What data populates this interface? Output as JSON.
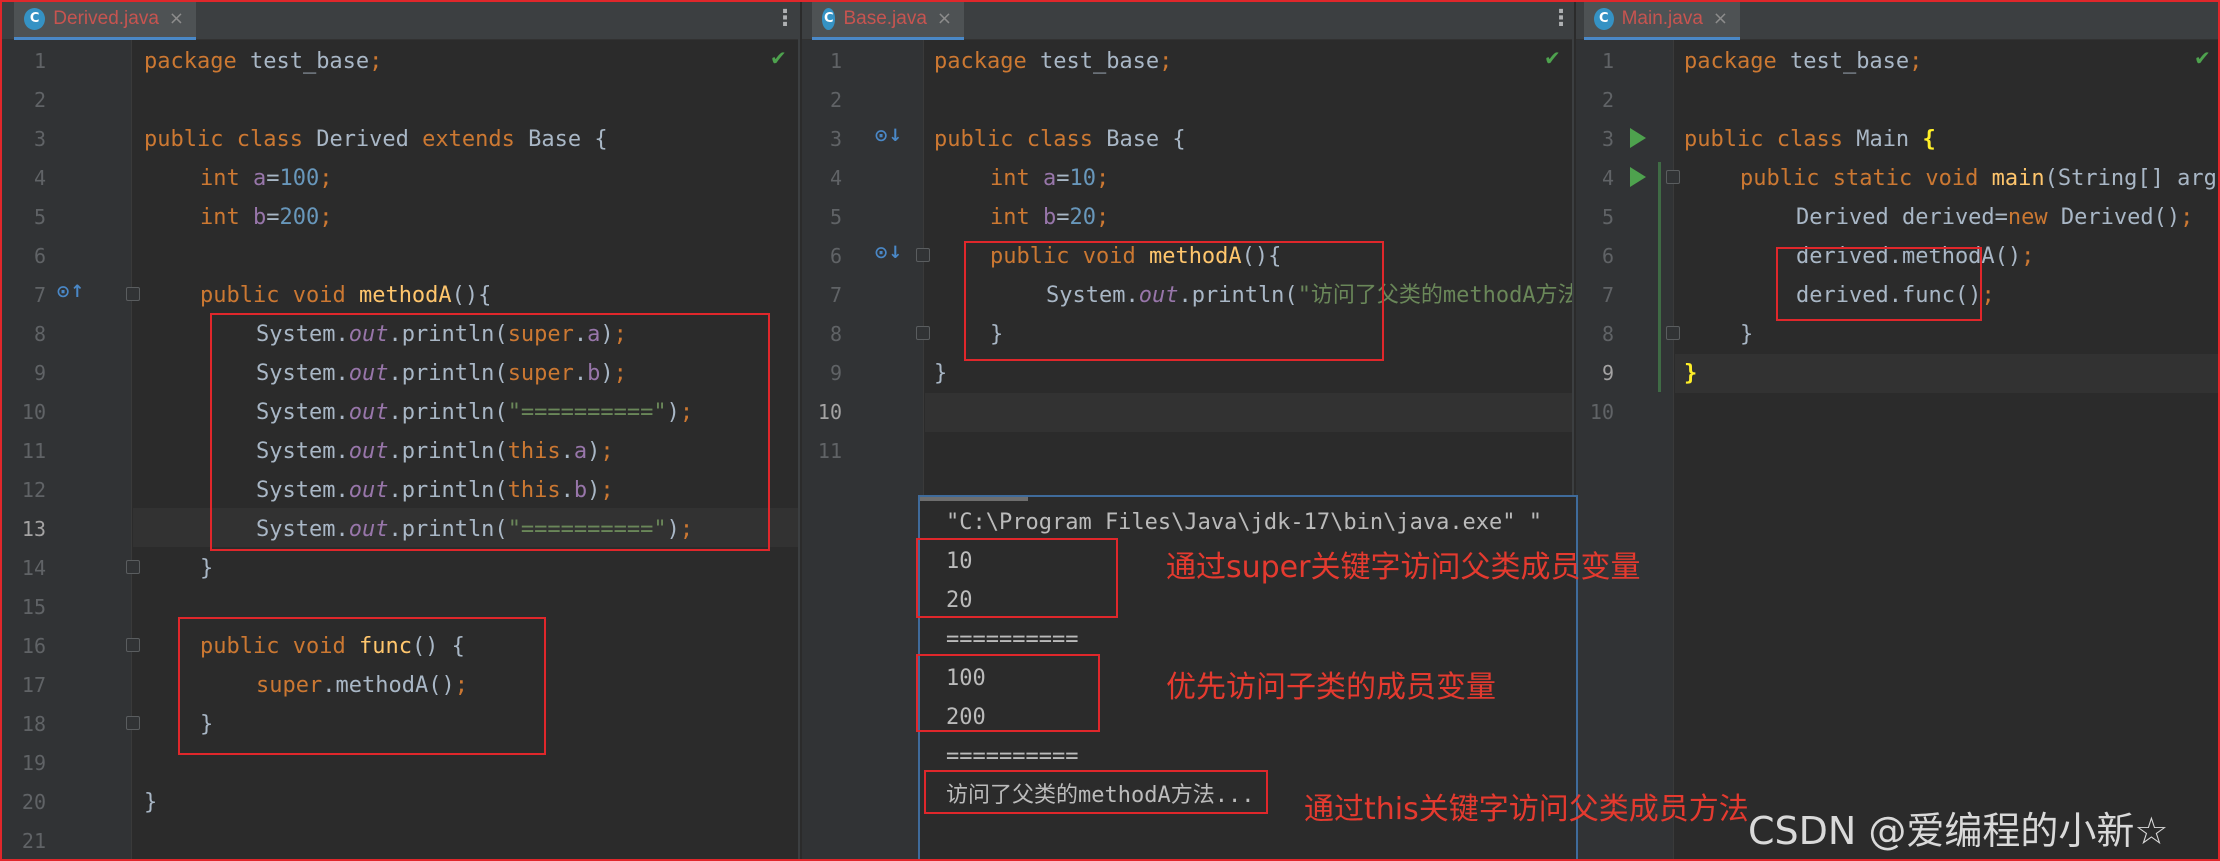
{
  "tabs": {
    "derived": "Derived.java",
    "base": "Base.java",
    "main": "Main.java",
    "icon_letter": "C",
    "close": "×",
    "menu": "⋮"
  },
  "derived": {
    "lines": [
      "1",
      "2",
      "3",
      "4",
      "5",
      "6",
      "7",
      "8",
      "9",
      "10",
      "11",
      "12",
      "13",
      "14",
      "15",
      "16",
      "17",
      "18",
      "19",
      "20",
      "21"
    ]
  },
  "base": {
    "lines": [
      "1",
      "2",
      "3",
      "4",
      "5",
      "6",
      "7",
      "8",
      "9",
      "10",
      "11"
    ]
  },
  "main": {
    "lines": [
      "1",
      "2",
      "3",
      "4",
      "5",
      "6",
      "7",
      "8",
      "9",
      "10"
    ]
  },
  "console": {
    "cmd": "\"C:\\Program Files\\Java\\jdk-17\\bin\\java.exe\" \"",
    "out": [
      "10",
      "20",
      "==========",
      "100",
      "200",
      "==========",
      "访问了父类的methodA方法..."
    ]
  },
  "annotations": {
    "super_field": "通过super关键字访问父类成员变量",
    "child_first": "优先访问子类的成员变量",
    "this_method": "通过this关键字访问父类成员方法"
  },
  "watermark": "CSDN @爱编程的小新☆",
  "icons": {
    "check": "✔",
    "run": "run-icon",
    "override": "override-icon",
    "implemented": "implemented-icon"
  },
  "colors": {
    "keyword": "#cc7832",
    "function": "#ffc66d",
    "number": "#6897bb",
    "field": "#9876aa",
    "string": "#6a8759",
    "annotation": "#e43a2f"
  }
}
